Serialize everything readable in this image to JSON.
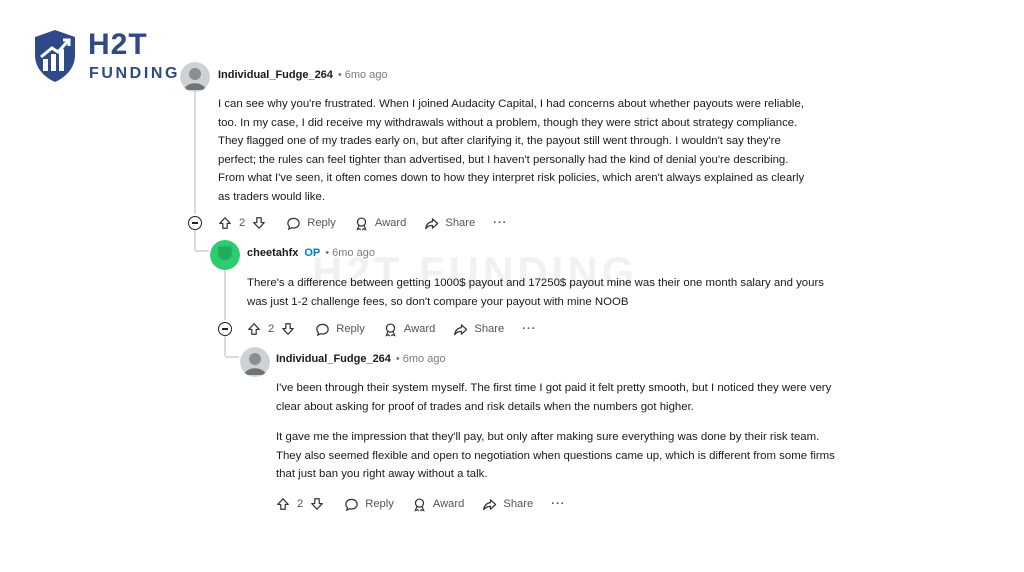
{
  "brand": {
    "main": "H2T",
    "sub": "FUNDING"
  },
  "watermark": "H2T FUNDING",
  "comments": [
    {
      "user": "Individual_Fudge_264",
      "time": "6mo ago",
      "paragraphs": [
        "I can see why you're frustrated. When I joined Audacity Capital, I had concerns about whether payouts were reliable, too. In my case, I did receive my withdrawals without a problem, though they were strict about strategy compliance. They flagged one of my trades early on, but after clarifying it, the payout still went through. I wouldn't say they're perfect; the rules can feel tighter than advertised, but I haven't personally had the kind of denial you're describing. From what I've seen, it often comes down to how they interpret risk policies, which aren't always explained as clearly as traders would like."
      ],
      "score": "2",
      "reply": "Reply",
      "award": "Award",
      "share": "Share",
      "more": "···"
    },
    {
      "user": "cheetahfx",
      "op": "OP",
      "time": "6mo ago",
      "paragraphs": [
        "There's a difference between getting 1000$ payout and 17250$ payout mine was their one month salary and yours was just 1-2 challenge fees, so don't compare your payout with mine NOOB"
      ],
      "score": "2",
      "reply": "Reply",
      "award": "Award",
      "share": "Share",
      "more": "···"
    },
    {
      "user": "Individual_Fudge_264",
      "time": "6mo ago",
      "paragraphs": [
        "I've been through their system myself. The first time I got paid it felt pretty smooth, but I noticed they were very clear about asking for proof of trades and risk details when the numbers got higher.",
        "It gave me the impression that they'll pay, but only after making sure everything was done by their risk team. They also seemed flexible and open to negotiation when questions came up, which is different from some firms that just ban you right away without a talk."
      ],
      "score": "2",
      "reply": "Reply",
      "award": "Award",
      "share": "Share",
      "more": "···"
    }
  ],
  "colors": {
    "brand": "#2f4a86",
    "op_badge": "#0079d3",
    "meta": "#7c7c7c",
    "avatar_op": "#2ecc71"
  },
  "icons": [
    "logo-shield-icon",
    "upvote-icon",
    "downvote-icon",
    "reply-icon",
    "award-icon",
    "share-icon",
    "more-icon",
    "collapse-icon"
  ]
}
